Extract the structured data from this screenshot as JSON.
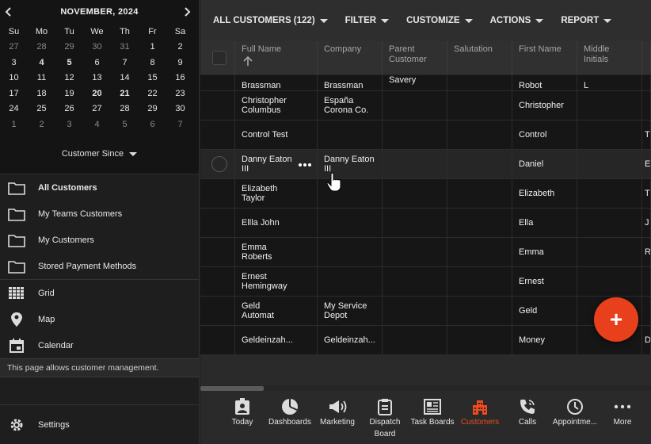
{
  "calendar": {
    "month_label": "NOVEMBER, 2024",
    "dows": [
      "Su",
      "Mo",
      "Tu",
      "We",
      "Th",
      "Fr",
      "Sa"
    ],
    "weeks": [
      [
        "27",
        "28",
        "29",
        "30",
        "31",
        "1",
        "2"
      ],
      [
        "3",
        "4",
        "5",
        "6",
        "7",
        "8",
        "9"
      ],
      [
        "10",
        "11",
        "12",
        "13",
        "14",
        "15",
        "16"
      ],
      [
        "17",
        "18",
        "19",
        "20",
        "21",
        "22",
        "23"
      ],
      [
        "24",
        "25",
        "26",
        "27",
        "28",
        "29",
        "30"
      ],
      [
        "1",
        "2",
        "3",
        "4",
        "5",
        "6",
        "7"
      ]
    ],
    "filter_label": "Customer Since"
  },
  "sidebar": {
    "lists": [
      {
        "label": "All Customers",
        "icon": "folder-icon"
      },
      {
        "label": "My Teams Customers",
        "icon": "folder-icon"
      },
      {
        "label": "My Customers",
        "icon": "folder-icon"
      },
      {
        "label": "Stored Payment Methods",
        "icon": "folder-icon"
      }
    ],
    "views": [
      {
        "label": "Grid",
        "icon": "grid-icon"
      },
      {
        "label": "Map",
        "icon": "map-pin-icon"
      },
      {
        "label": "Calendar",
        "icon": "calendar-icon"
      }
    ],
    "info_text": "This page allows customer management.",
    "settings_label": "Settings"
  },
  "toolbar": {
    "items": [
      "ALL CUSTOMERS (122)",
      "FILTER",
      "CUSTOMIZE",
      "ACTIONS",
      "REPORT"
    ]
  },
  "table": {
    "headers": [
      "Full Name",
      "Company",
      "Parent Customer",
      "Salutation",
      "First Name",
      "Middle Initials"
    ],
    "partial_row": {
      "full_name": "Brassman",
      "company": "Brassman",
      "parent": "Savery",
      "first_name": "Robot",
      "middle": "L"
    },
    "rows": [
      {
        "full_name": "Christopher\nColumbus",
        "company": "España\nCorona Co.",
        "first_name": "Christopher",
        "extra": ""
      },
      {
        "full_name": "Control Test",
        "company": "",
        "first_name": "Control",
        "extra": "T"
      },
      {
        "full_name": "Danny Eaton\nIII",
        "company": "Danny Eaton\nIII",
        "first_name": "Daniel",
        "extra": "E"
      },
      {
        "full_name": "Elizabeth\nTaylor",
        "company": "",
        "first_name": "Elizabeth",
        "extra": "T"
      },
      {
        "full_name": "Ellla John",
        "company": "",
        "first_name": "Ella",
        "extra": "J"
      },
      {
        "full_name": "Emma\nRoberts",
        "company": "",
        "first_name": "Emma",
        "extra": "R"
      },
      {
        "full_name": "Ernest\nHemingway",
        "company": "",
        "first_name": "Ernest",
        "extra": ""
      },
      {
        "full_name": "Geld\nAutomat",
        "company": "My Service\nDepot",
        "first_name": "Geld",
        "extra": ""
      },
      {
        "full_name": "Geldeinzah...",
        "company": "Geldeinzah...",
        "first_name": "Money",
        "extra": "D"
      }
    ]
  },
  "fab_label": "+",
  "bottom_nav": [
    {
      "label": "Today",
      "icon": "badge-icon"
    },
    {
      "label": "Dashboards",
      "icon": "pie-chart-icon"
    },
    {
      "label": "Marketing",
      "icon": "megaphone-icon"
    },
    {
      "label": "Dispatch\nBoard",
      "icon": "clipboard-icon"
    },
    {
      "label": "Task Boards",
      "icon": "task-board-icon"
    },
    {
      "label": "Customers",
      "icon": "building-icon"
    },
    {
      "label": "Calls",
      "icon": "phone-icon"
    },
    {
      "label": "Appointme...",
      "icon": "clock-icon"
    },
    {
      "label": "More",
      "icon": "more-icon"
    }
  ],
  "colors": {
    "accent": "#e8401c",
    "active_nav": "#f04a1f"
  }
}
